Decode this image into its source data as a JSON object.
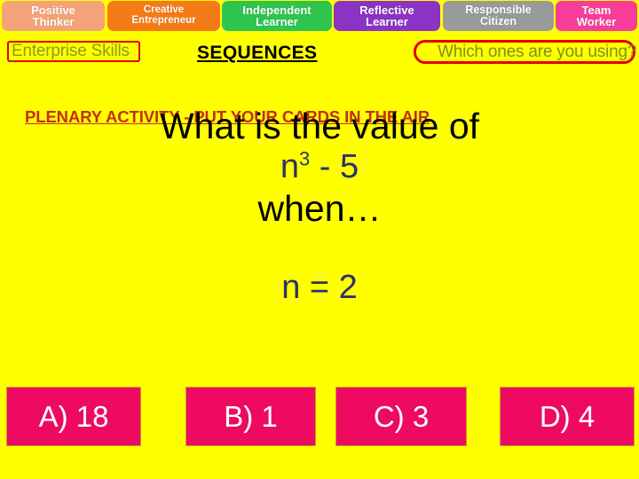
{
  "skills_banner": {
    "tabs": [
      {
        "id": "positive-thinker",
        "line1": "Positive",
        "line2": "Thinker",
        "color": "#F4A277"
      },
      {
        "id": "creative-entrepreneur",
        "line1": "Creative",
        "line2": "Entrepreneur",
        "color": "#F47B16"
      },
      {
        "id": "independent-learner",
        "line1": "Independent",
        "line2": "Learner",
        "color": "#2FC44E"
      },
      {
        "id": "reflective-learner",
        "line1": "Reflective",
        "line2": "Learner",
        "color": "#8A33C4"
      },
      {
        "id": "responsible-citizen",
        "line1": "Responsible",
        "line2": "Citizen",
        "color": "#9A9A9A"
      },
      {
        "id": "team-worker",
        "line1": "Team",
        "line2": "Worker",
        "color": "#F73D99"
      }
    ]
  },
  "info_band": {
    "enterprise_skills_label": "Enterprise Skills",
    "topic_title": "SEQUENCES",
    "which_ones_prompt": "Which ones are you using?",
    "plenary_line": "PLENARY ACTIVITY - PUT YOUR CARDS IN THE AIR",
    "red_outline_color": "#E00000",
    "green_text_color": "#8A9A22",
    "plenary_text_color": "#C42E18"
  },
  "question": {
    "line_1": "What is the value of",
    "expression_base": "n",
    "expression_exponent": "3",
    "expression_tail": " - 5",
    "line_3": "when…",
    "given_value": "n = 2",
    "expression_color": "#2D3168"
  },
  "answers": {
    "option_a": "A) 18",
    "option_b": "B) 1",
    "option_c": "C) 3",
    "option_d": "D) 4",
    "button_color": "#EE0A61",
    "button_text_color": "#FFFFFF"
  },
  "page": {
    "background_color": "#FFFF00"
  }
}
